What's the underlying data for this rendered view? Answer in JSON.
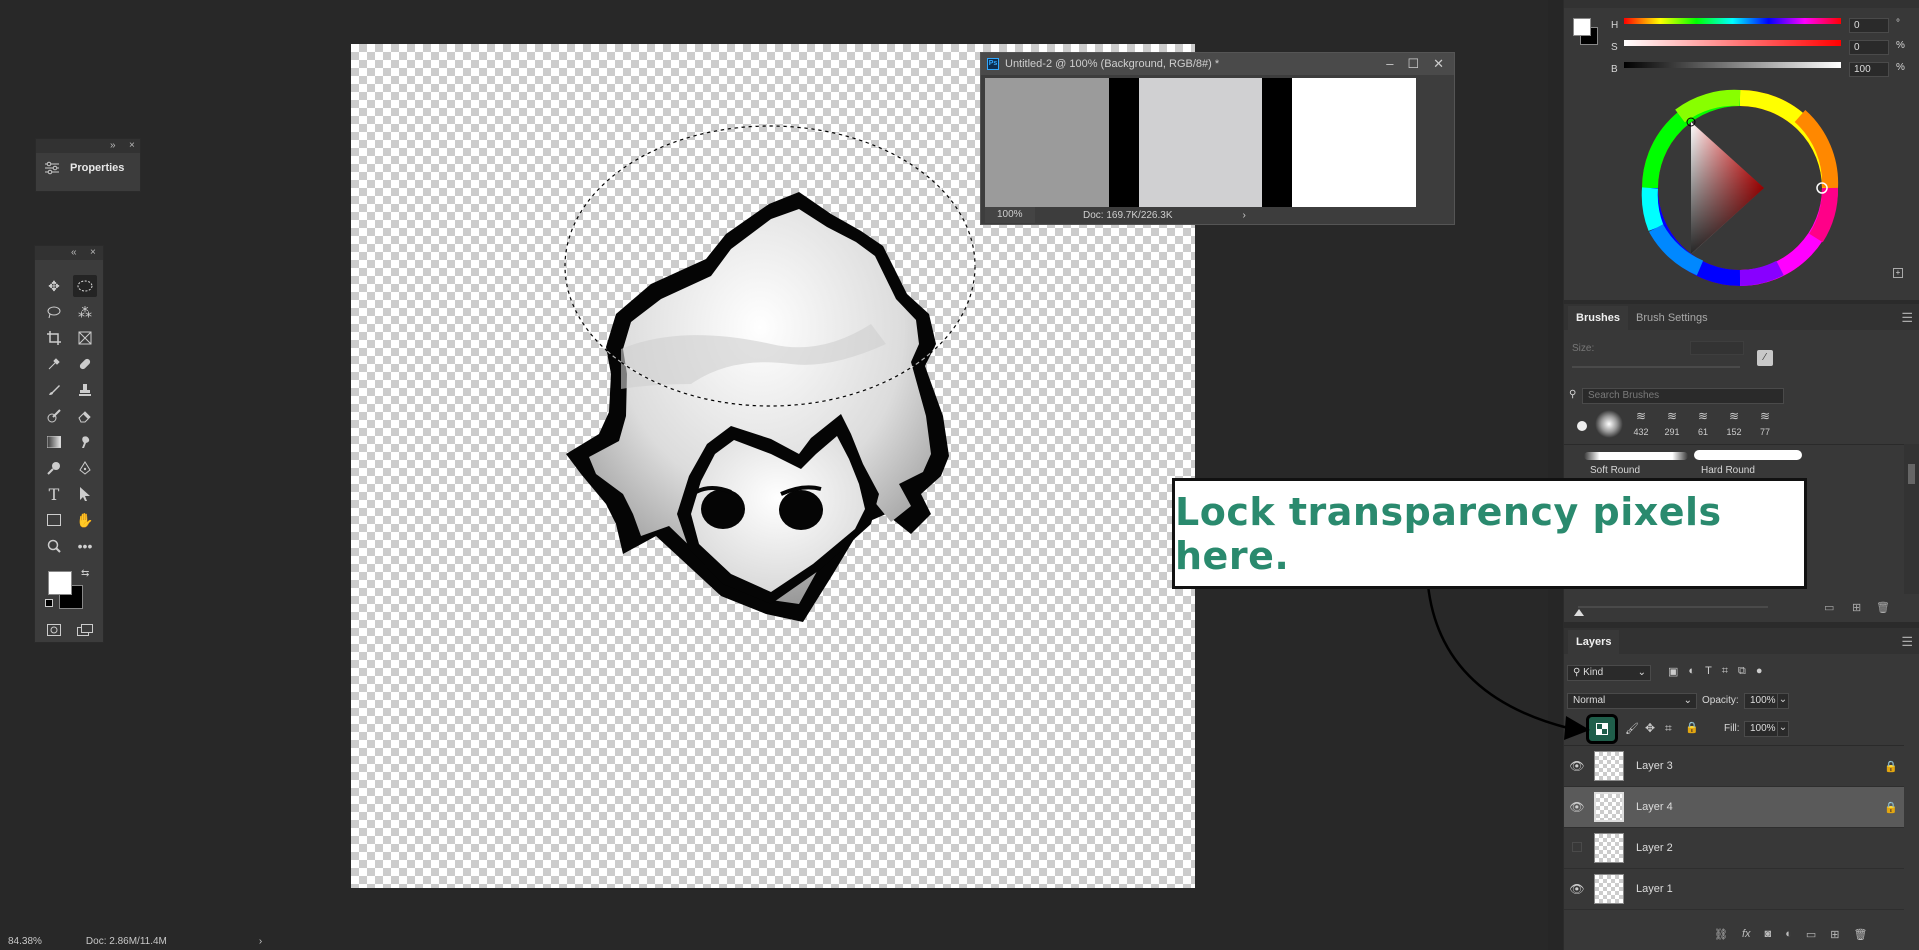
{
  "properties_panel": {
    "title": "Properties",
    "collapse": "»",
    "close": "×"
  },
  "toolbar": {
    "collapse": "«",
    "close": "×"
  },
  "document": {
    "title": "Untitled-2 @ 100% (Background, RGB/8#) *",
    "zoom": "100%",
    "doc_info": "Doc: 169.7K/226.3K",
    "arrow": "›",
    "swatches": [
      "#9b9b9b",
      "#000000",
      "#d0d0d2",
      "#000000",
      "#ffffff"
    ]
  },
  "color_panel": {
    "h_label": "H",
    "h_value": "0",
    "h_unit": "°",
    "s_label": "S",
    "s_value": "0",
    "s_unit": "%",
    "b_label": "B",
    "b_value": "100",
    "b_unit": "%"
  },
  "brushes_panel": {
    "tabs": [
      "Brushes",
      "Brush Settings"
    ],
    "size_label": "Size:",
    "search_placeholder": "Search Brushes",
    "presets": [
      "432",
      "291",
      "61",
      "152",
      "77"
    ],
    "soft_round": "Soft Round",
    "hard_round": "Hard Round"
  },
  "layers_panel": {
    "tab": "Layers",
    "filter": "Kind",
    "blend_mode": "Normal",
    "opacity_label": "Opacity:",
    "opacity_value": "100%",
    "fill_label": "Fill:",
    "fill_value": "100%",
    "layers": [
      {
        "name": "Layer 3",
        "visible": true,
        "locked": true
      },
      {
        "name": "Layer 4",
        "visible": true,
        "locked": true,
        "selected": true
      },
      {
        "name": "Layer 2",
        "visible": false,
        "locked": false
      },
      {
        "name": "Layer 1",
        "visible": true,
        "locked": false
      }
    ]
  },
  "callout": {
    "text": "Lock transparency pixels here."
  },
  "statusbar": {
    "zoom": "84.38%",
    "doc_info": "Doc: 2.86M/11.4M",
    "arrow": "›"
  },
  "colors": {
    "callout_text": "#2a8a6e",
    "lock_highlight": "#1f5e4a"
  }
}
